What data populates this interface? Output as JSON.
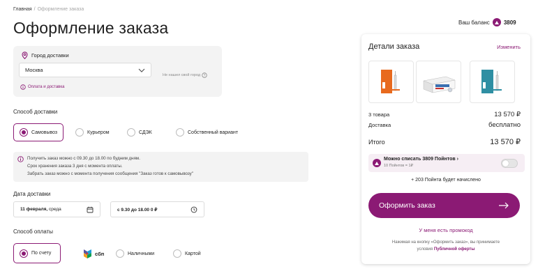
{
  "breadcrumb": {
    "home": "Главная",
    "separator": "/",
    "current": "Оформление заказа"
  },
  "page_title": "Оформление заказа",
  "city": {
    "label": "Город доставки",
    "value": "Москва",
    "not_found": "Не нашел свой город",
    "payment_delivery": "Оплата и доставка"
  },
  "delivery": {
    "label": "Способ доставки",
    "options": [
      {
        "label": "Самовывоз",
        "selected": true
      },
      {
        "label": "Курьером",
        "selected": false
      },
      {
        "label": "СДЭК",
        "selected": false
      },
      {
        "label": "Собственный вариант",
        "selected": false
      }
    ]
  },
  "info": {
    "lines": [
      "Получить заказ можно с 09.30 до 18.00 по будним дням.",
      "Срок хранения заказа 3 дня с момента оплаты.",
      "Забрать заказ можно с момента получения сообщения \"Заказ готов к самовывозу\""
    ]
  },
  "delivery_date": {
    "label": "Дата доставки",
    "date_bold": "11 февраля,",
    "date_rest": "среда",
    "time": "с 9.30 до 18.00 0 ₽"
  },
  "payment": {
    "label": "Способ оплаты",
    "options": [
      {
        "label": "По счету",
        "selected": true
      },
      {
        "label": "сбп",
        "selected": false
      },
      {
        "label": "Наличными",
        "selected": false
      },
      {
        "label": "Картой",
        "selected": false
      }
    ]
  },
  "balance": {
    "label": "Ваш баланс",
    "value": "3809"
  },
  "order": {
    "title": "Детали заказа",
    "edit": "Изменить",
    "items_label": "3 товара",
    "items_value": "13 570 ₽",
    "delivery_label": "Доставка",
    "delivery_value": "бесплатно",
    "total_label": "Итого",
    "total_value": "13 570 ₽",
    "points_title": "Можно списать 3809 Пойнтов",
    "points_sub": "10 Пойнтов = 1₽",
    "points_bonus": "+ 203 Пойнта будет начислено",
    "checkout": "Оформить заказ",
    "promo": "У меня есть промокод",
    "terms_prefix": "Нажимая на кнопку «Оформить заказ», вы принимаете",
    "terms_word": "условия",
    "terms_link": "Публичной оферты"
  },
  "colors": {
    "accent": "#8b1a74",
    "card_bg": "#f3f3f3"
  }
}
